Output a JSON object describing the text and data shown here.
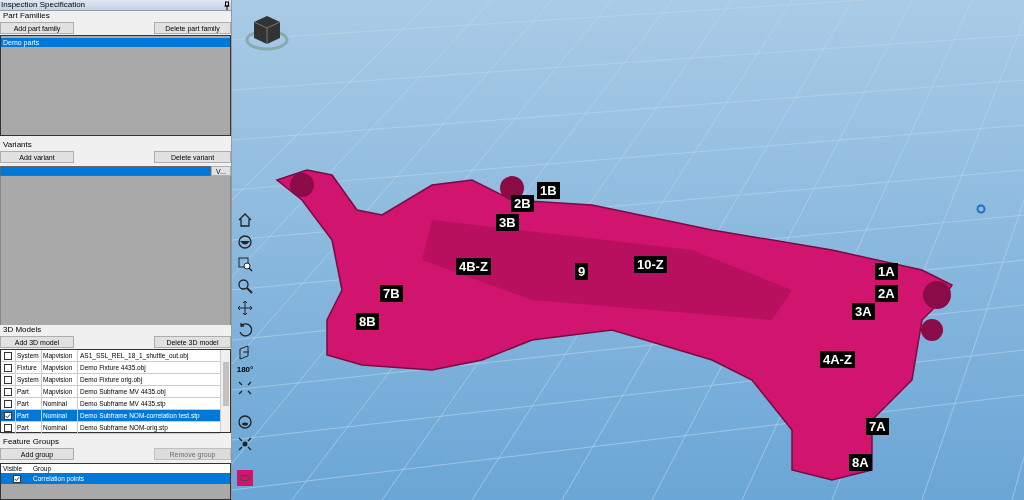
{
  "panel": {
    "title": "Inspection Specification"
  },
  "part_families": {
    "heading": "Part Families",
    "add_button": "Add part family",
    "delete_button": "Delete part family",
    "items": [
      {
        "label": "Demo parts",
        "selected": true
      }
    ]
  },
  "variants": {
    "heading": "Variants",
    "add_button": "Add variant",
    "delete_button": "Delete variant",
    "dropdown_button": "V..."
  },
  "models": {
    "heading": "3D Models",
    "add_button": "Add 3D model",
    "delete_button": "Delete 3D model",
    "rows": [
      {
        "checked": false,
        "selected": false,
        "type": "System",
        "source": "Mapvision",
        "file": "AS1_SSL_REL_18_1_shuttle_out.obj"
      },
      {
        "checked": false,
        "selected": false,
        "type": "Fixture",
        "source": "Mapvision",
        "file": "Demo Fixture 4435.obj"
      },
      {
        "checked": false,
        "selected": false,
        "type": "System",
        "source": "Mapvision",
        "file": "Demo Fixture orig.obj"
      },
      {
        "checked": false,
        "selected": false,
        "type": "Part",
        "source": "Mapvision",
        "file": "Demo Subframe MV 4435.obj"
      },
      {
        "checked": false,
        "selected": false,
        "type": "Part",
        "source": "Nominal",
        "file": "Demo Subframe MV 4435.stp"
      },
      {
        "checked": true,
        "selected": true,
        "type": "Part",
        "source": "Nominal",
        "file": "Demo Subframe NOM-correlation test.stp"
      },
      {
        "checked": false,
        "selected": false,
        "type": "Part",
        "source": "Nominal",
        "file": "Demo Subframe NOM-orig.stp"
      }
    ]
  },
  "feature_groups": {
    "heading": "Feature Groups",
    "add_button": "Add group",
    "remove_button": "Remove group",
    "remove_disabled": true,
    "columns": [
      "Visible",
      "Group"
    ],
    "rows": [
      {
        "visible": true,
        "selected": true,
        "group": "Correlation points"
      }
    ]
  },
  "toolbar": {
    "rotate_label": "180°"
  },
  "viewport": {
    "labels": [
      "1B",
      "2B",
      "3B",
      "4B-Z",
      "9",
      "10-Z",
      "7B",
      "8B",
      "1A",
      "2A",
      "3A",
      "4A-Z",
      "7A",
      "8A"
    ]
  }
}
